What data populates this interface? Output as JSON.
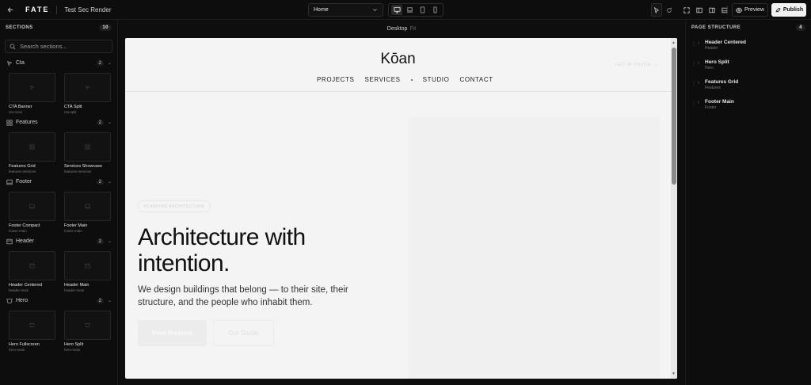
{
  "topbar": {
    "back_icon": "arrow-left-icon",
    "logo": "FATE",
    "project_name": "Test Sec Render",
    "page_select": "Home",
    "devices": [
      "desktop",
      "laptop",
      "tablet",
      "mobile"
    ],
    "active_device": "desktop",
    "preview_label": "Preview",
    "publish_label": "Publish"
  },
  "sections_panel": {
    "title": "SECTIONS",
    "count": "10",
    "search_placeholder": "Search sections...",
    "categories": [
      {
        "name": "Cta",
        "count": "2",
        "icon": "sparkle-icon",
        "items": [
          {
            "title": "CTA Banner",
            "id": "cta-main"
          },
          {
            "title": "CTA Split",
            "id": "cta-split"
          }
        ]
      },
      {
        "name": "Features",
        "count": "2",
        "icon": "grid-icon",
        "items": [
          {
            "title": "Features Grid",
            "id": "features-services"
          },
          {
            "title": "Services Showcase",
            "id": "features-services"
          }
        ]
      },
      {
        "name": "Footer",
        "count": "2",
        "icon": "footer-layout-icon",
        "items": [
          {
            "title": "Footer Compact",
            "id": "footer-main"
          },
          {
            "title": "Footer Main",
            "id": "footer-main"
          }
        ]
      },
      {
        "name": "Header",
        "count": "2",
        "icon": "header-layout-icon",
        "items": [
          {
            "title": "Header Centered",
            "id": "header-main"
          },
          {
            "title": "Header Main",
            "id": "header-main"
          }
        ]
      },
      {
        "name": "Hero",
        "count": "2",
        "icon": "hero-icon",
        "items": [
          {
            "title": "Hero Fullscreen",
            "id": "hero-main"
          },
          {
            "title": "Hero Split",
            "id": "hero-main"
          }
        ]
      }
    ]
  },
  "canvas": {
    "device_label": "Desktop",
    "fit_label": "Fit",
    "site": {
      "brand": "Kōan",
      "nav": [
        "PROJECTS",
        "SERVICES",
        "STUDIO",
        "CONTACT"
      ],
      "get_in_touch": "GET IN TOUCH →",
      "badge": "PLANNING ARCHITECTURE",
      "headline": "Architecture with intention.",
      "subhead": "We design buildings that belong — to their site, their structure, and the people who inhabit them.",
      "primary_cta": "View Projects",
      "secondary_cta": "Our Studio"
    }
  },
  "structure_panel": {
    "title": "PAGE STRUCTURE",
    "count": "4",
    "items": [
      {
        "title": "Header Centered",
        "type": "Header"
      },
      {
        "title": "Hero Split",
        "type": "Hero"
      },
      {
        "title": "Features Grid",
        "type": "Features"
      },
      {
        "title": "Footer Main",
        "type": "Footer"
      }
    ]
  },
  "colors": {
    "app_bg": "#0d0d0d",
    "canvas_bg": "#f4f4f4",
    "publish_bg": "#f2f2f2",
    "text_primary": "#111111"
  }
}
